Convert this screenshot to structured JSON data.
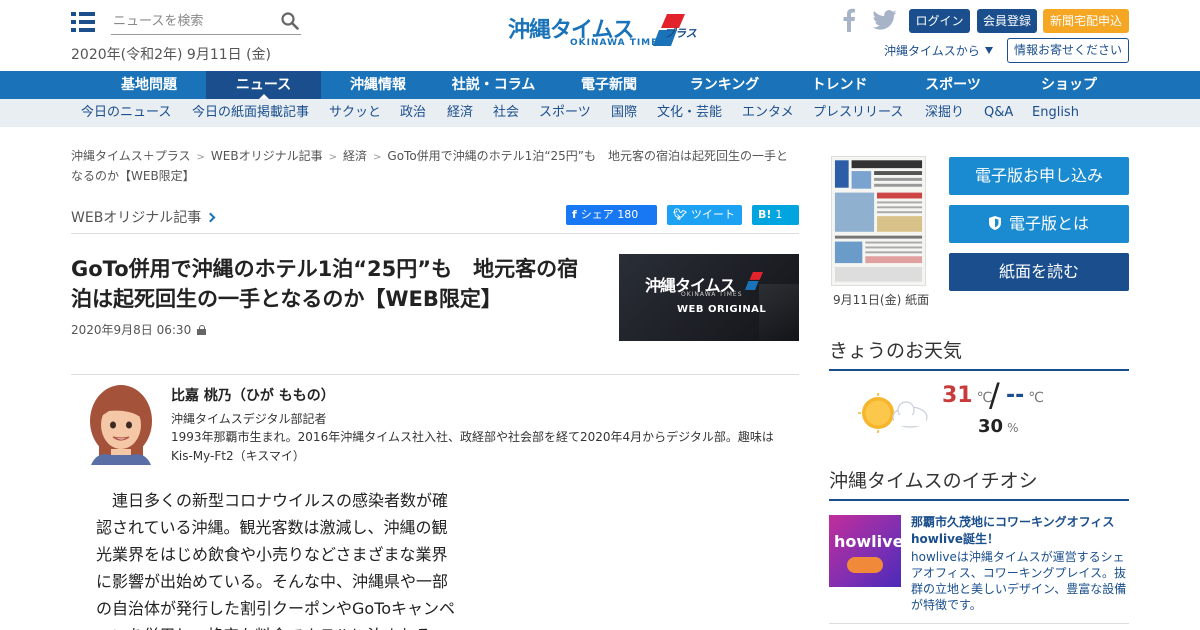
{
  "header": {
    "search_placeholder": "ニュースを検索",
    "date": "2020年(令和2年) 9月11日 (金)",
    "logo_text": "沖縄タイムス",
    "logo_sub": "OKINAWA TIMES",
    "logo_plus": "プラス",
    "login_label": "ログイン",
    "register_label": "会員登録",
    "delivery_label": "新聞宅配申込",
    "from_times_label": "沖縄タイムスから",
    "info_label": "情報お寄せください",
    "colors": {
      "brand": "#1a73b8",
      "navy": "#1a4e8c",
      "accent": "#f5a623"
    }
  },
  "main_nav": [
    {
      "label": "基地問題"
    },
    {
      "label": "ニュース",
      "active": true
    },
    {
      "label": "沖縄情報"
    },
    {
      "label": "社説・コラム"
    },
    {
      "label": "電子新聞"
    },
    {
      "label": "ランキング"
    },
    {
      "label": "トレンド"
    },
    {
      "label": "スポーツ"
    },
    {
      "label": "ショップ"
    }
  ],
  "sub_nav": [
    {
      "label": "今日のニュース"
    },
    {
      "label": "今日の紙面掲載記事"
    },
    {
      "label": "サクッと"
    },
    {
      "label": "政治"
    },
    {
      "label": "経済"
    },
    {
      "label": "社会"
    },
    {
      "label": "スポーツ"
    },
    {
      "label": "国際"
    },
    {
      "label": "文化・芸能"
    },
    {
      "label": "エンタメ"
    },
    {
      "label": "プレスリリース"
    },
    {
      "label": "深掘り"
    },
    {
      "label": "Q&A"
    },
    {
      "label": "English"
    }
  ],
  "breadcrumb": [
    "沖縄タイムス＋プラス",
    "WEBオリジナル記事",
    "経済",
    "GoTo併用で沖縄のホテル1泊“25円”も　地元客の宿泊は起死回生の一手となるのか【WEB限定】"
  ],
  "article": {
    "category": "WEBオリジナル記事",
    "share": {
      "fb_label": "シェア",
      "fb_count": "180",
      "tw_label": "ツイート",
      "hb_label": "B!",
      "hb_count": "1"
    },
    "headline": "GoTo併用で沖縄のホテル1泊“25円”も　地元客の宿泊は起死回生の一手となるのか【WEB限定】",
    "pubdate": "2020年9月8日 06:30",
    "thumb_logo": "沖縄タイムス",
    "thumb_sub": "OKINAWA TIMES",
    "thumb_caption": "WEB ORIGINAL",
    "author": {
      "name": "比嘉 桃乃（ひが ももの）",
      "title": "沖縄タイムスデジタル部記者",
      "bio": "1993年那覇市生まれ。2016年沖縄タイムス社入社、政経部や社会部を経て2020年4月からデジタル部。趣味はKis-My-Ft2（キスマイ）"
    },
    "body": "連日多くの新型コロナウイルスの感染者数が確認されている沖縄。観光客数は激減し、沖縄の観光業界をはじめ飲食や小売りなどさまざまな業界に影響が出始めている。そんな中、沖縄県や一部の自治体が発行した割引クーポンやGoToキャンペーンを併用し、格安な料金でホテルに泊まれる"
  },
  "sidebar": {
    "paper_caption": "9月11日(金) 紙面",
    "apply_label": "電子版お申し込み",
    "about_label": "電子版とは",
    "read_label": "紙面を読む",
    "weather_heading": "きょうのお天気",
    "weather": {
      "icon": "sun-cloud-icon",
      "high": "31",
      "low": "--",
      "temp_unit": "℃",
      "rain": "30",
      "rain_unit": "%"
    },
    "pick_heading": "沖縄タイムスのイチオシ",
    "pick": {
      "img_text": "howlive",
      "title": "那覇市久茂地にコワーキングオフィスhowlive誕生！",
      "desc": "howliveは沖縄タイムスが運営するシェアオフィス、コワーキングプレイス。抜群の立地と美しいデザイン、豊富な設備が特徴です。"
    }
  }
}
